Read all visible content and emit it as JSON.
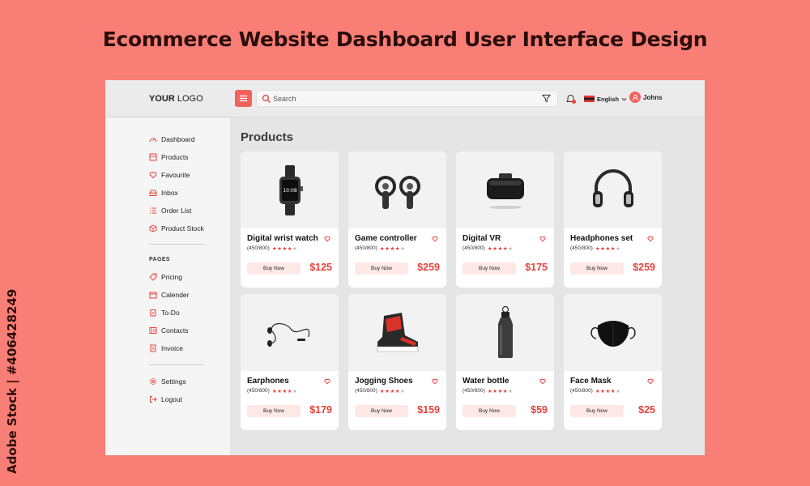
{
  "page": {
    "title": "Ecommerce Website Dashboard User Interface Design",
    "watermark": "Adobe Stock | #406428249"
  },
  "topbar": {
    "logo_bold": "YOUR",
    "logo_rest": " LOGO",
    "search_placeholder": "Search",
    "language": "English",
    "user": "Johns",
    "notifications": "3"
  },
  "sidebar": {
    "items": [
      {
        "label": "Dashboard",
        "icon": "dashboard-icon"
      },
      {
        "label": "Products",
        "icon": "products-icon"
      },
      {
        "label": "Favourite",
        "icon": "heart-icon"
      },
      {
        "label": "Inbox",
        "icon": "inbox-icon"
      },
      {
        "label": "Order List",
        "icon": "list-icon"
      },
      {
        "label": "Product Stock",
        "icon": "box-icon"
      }
    ],
    "pages_heading": "PAGES",
    "pages": [
      {
        "label": "Pricing",
        "icon": "tag-icon"
      },
      {
        "label": "Calender",
        "icon": "calendar-icon"
      },
      {
        "label": "To-Do",
        "icon": "clipboard-icon"
      },
      {
        "label": "Contacts",
        "icon": "contacts-icon"
      },
      {
        "label": "Invoice",
        "icon": "invoice-icon"
      }
    ],
    "bottom": [
      {
        "label": "Settings",
        "icon": "gear-icon"
      },
      {
        "label": "Logout",
        "icon": "logout-icon"
      }
    ]
  },
  "main": {
    "title": "Products",
    "products": [
      {
        "name": "Digital wrist watch",
        "reviews": "(450/800)",
        "rating": 4,
        "buy": "Buy Now",
        "price": "$125",
        "image": "smartwatch"
      },
      {
        "name": "Game controller",
        "reviews": "(450/800)",
        "rating": 4,
        "buy": "Buy Now",
        "price": "$259",
        "image": "vr-controllers"
      },
      {
        "name": "Digital VR",
        "reviews": "(450/800)",
        "rating": 4,
        "buy": "Buy Now",
        "price": "$175",
        "image": "vr-headset"
      },
      {
        "name": "Headphones set",
        "reviews": "(450/800)",
        "rating": 4,
        "buy": "Buy Now",
        "price": "$259",
        "image": "headphones"
      },
      {
        "name": "Earphones",
        "reviews": "(450/800)",
        "rating": 4,
        "buy": "Buy Now",
        "price": "$179",
        "image": "earphones"
      },
      {
        "name": "Jogging Shoes",
        "reviews": "(450/800)",
        "rating": 4,
        "buy": "Buy Now",
        "price": "$159",
        "image": "sneaker"
      },
      {
        "name": "Water bottle",
        "reviews": "(450/800)",
        "rating": 4,
        "buy": "Buy Now",
        "price": "$59",
        "image": "water-bottle"
      },
      {
        "name": "Face Mask",
        "reviews": "(450/800)",
        "rating": 4,
        "buy": "Buy Now",
        "price": "$25",
        "image": "face-mask"
      }
    ]
  },
  "colors": {
    "background": "#f97e75",
    "accent": "#e8413a",
    "button_bg": "#fde8e6"
  }
}
